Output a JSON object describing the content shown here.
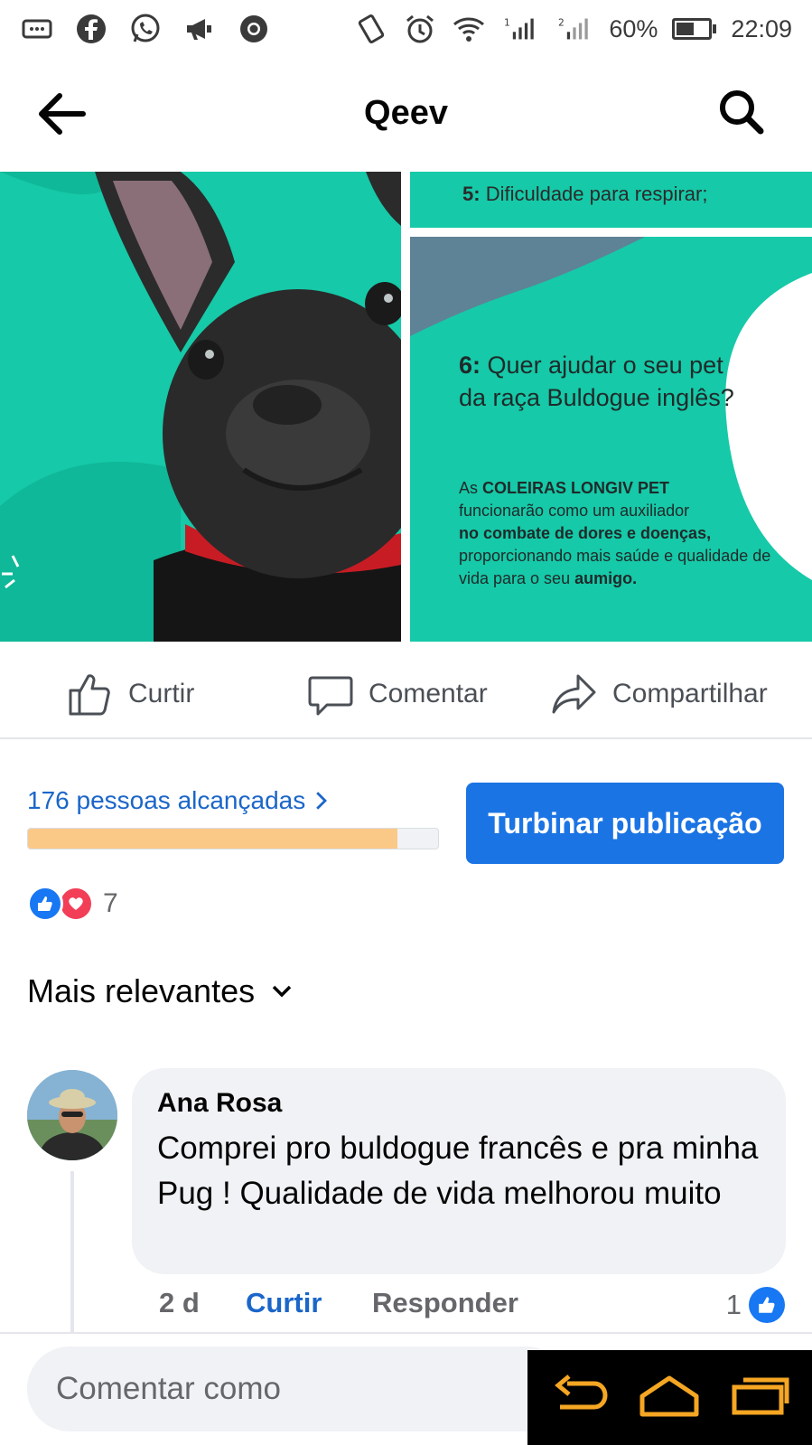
{
  "status_bar": {
    "battery": "60%",
    "time": "22:09",
    "sim1": "1",
    "sim2": "2",
    "battery_level": 0.6,
    "icons": [
      "messages-icon",
      "facebook-icon",
      "whatsapp-icon",
      "megaphone-icon",
      "chrome-icon",
      "vibrate-icon",
      "alarm-icon",
      "wifi-icon",
      "signal-icon"
    ]
  },
  "header": {
    "title": "Qeev"
  },
  "post_images": {
    "right_top_line_num": "5:",
    "right_top_line_text": "Dificuldade para respirar;",
    "q_num": "6:",
    "q_text": "Quer ajudar o seu pet da raça Buldogue inglês?",
    "p_as": "As",
    "p_brand": "COLEIRAS LONGIV PET",
    "p_text1": "funcionarão como um auxiliador",
    "p_bold": "no combate de dores e doenças,",
    "p_text2": "proporcionando mais saúde e qualidade de vida para o seu",
    "p_end": "aumigo."
  },
  "actions": {
    "like": "Curtir",
    "comment": "Comentar",
    "share": "Compartilhar"
  },
  "reach": {
    "label": "176 pessoas alcançadas",
    "progress": 0.9,
    "boost": "Turbinar publicação"
  },
  "reactions": {
    "count": "7"
  },
  "sort": {
    "label": "Mais relevantes"
  },
  "comment": {
    "author": "Ana Rosa",
    "text": "Comprei pro buldogue francês e pra minha Pug ! Qualidade de vida melhorou muito",
    "time": "2 d",
    "like": "Curtir",
    "reply": "Responder",
    "likes": "1"
  },
  "composer": {
    "placeholder": "Comentar como"
  },
  "colors": {
    "teal": "#16c9a8",
    "blue": "#1b74e4",
    "link_blue": "#1b66c9",
    "reach_fill": "#fbc987"
  }
}
